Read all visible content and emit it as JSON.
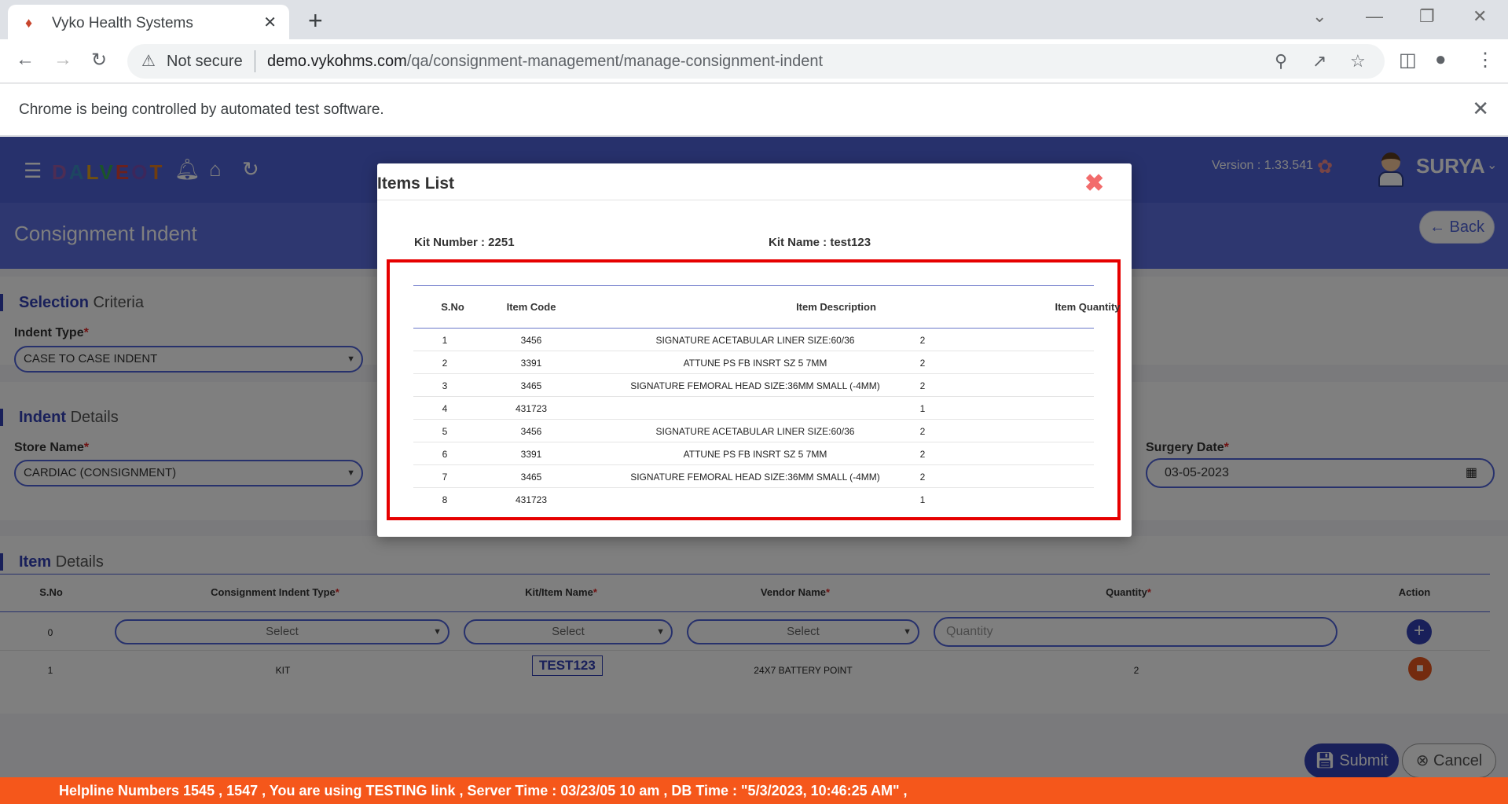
{
  "browser": {
    "tab_title": "Vyko Health Systems",
    "security_label": "Not secure",
    "url_host": "demo.vykohms.com",
    "url_path": "/qa/consignment-management/manage-consignment-indent",
    "infobar_text": "Chrome is being controlled by automated test software."
  },
  "header": {
    "logo_letters": [
      "D",
      "A",
      "L",
      "V",
      "E",
      "O",
      "T"
    ],
    "version": "Version : 1.33.541",
    "username": "SURYA"
  },
  "page": {
    "title": "Consignment Indent",
    "back_label": "Back"
  },
  "selection": {
    "heading_bold": "Selection",
    "heading_rest": "Criteria",
    "indent_type_label": "Indent Type",
    "indent_type_value": "CASE TO CASE INDENT"
  },
  "indent": {
    "heading_bold": "Indent",
    "heading_rest": "Details",
    "store_label": "Store Name",
    "store_value": "CARDIAC (CONSIGNMENT)",
    "surgery_label": "Surgery Date",
    "surgery_value": "03-05-2023"
  },
  "items": {
    "heading_bold": "Item",
    "heading_rest": "Details",
    "columns": [
      "S.No",
      "Consignment Indent Type",
      "Kit/Item Name",
      "Vendor Name",
      "Quantity",
      "Action"
    ],
    "entry_row": {
      "sno": "0",
      "type_placeholder": "Select",
      "kit_placeholder": "Select",
      "vendor_placeholder": "Select",
      "qty_placeholder": "Quantity"
    },
    "rows": [
      {
        "sno": "1",
        "type": "KIT",
        "kit": "TEST123",
        "vendor": "24X7 BATTERY POINT",
        "qty": "2"
      }
    ]
  },
  "actions": {
    "submit": "Submit",
    "cancel": "Cancel"
  },
  "helpline": "Helpline Numbers 1545 , 1547 , You are using TESTING link , Server Time : 03/23/05 10 am , DB Time : \"5/3/2023, 10:46:25 AM\" ,",
  "modal": {
    "title": "Items List",
    "kit_number_label": "Kit Number : 2251",
    "kit_name_label": "Kit Name : test123",
    "columns": [
      "S.No",
      "Item Code",
      "Item Description",
      "Item Quantity"
    ],
    "rows": [
      {
        "sno": "1",
        "code": "3456",
        "desc": "SIGNATURE ACETABULAR LINER SIZE:60/36",
        "qty": "2"
      },
      {
        "sno": "2",
        "code": "3391",
        "desc": "ATTUNE PS FB INSRT SZ 5 7MM",
        "qty": "2"
      },
      {
        "sno": "3",
        "code": "3465",
        "desc": "SIGNATURE FEMORAL HEAD SIZE:36MM SMALL (-4MM)",
        "qty": "2"
      },
      {
        "sno": "4",
        "code": "431723",
        "desc": "",
        "qty": "1"
      },
      {
        "sno": "5",
        "code": "3456",
        "desc": "SIGNATURE ACETABULAR LINER SIZE:60/36",
        "qty": "2"
      },
      {
        "sno": "6",
        "code": "3391",
        "desc": "ATTUNE PS FB INSRT SZ 5 7MM",
        "qty": "2"
      },
      {
        "sno": "7",
        "code": "3465",
        "desc": "SIGNATURE FEMORAL HEAD SIZE:36MM SMALL (-4MM)",
        "qty": "2"
      },
      {
        "sno": "8",
        "code": "431723",
        "desc": "",
        "qty": "1"
      }
    ]
  }
}
